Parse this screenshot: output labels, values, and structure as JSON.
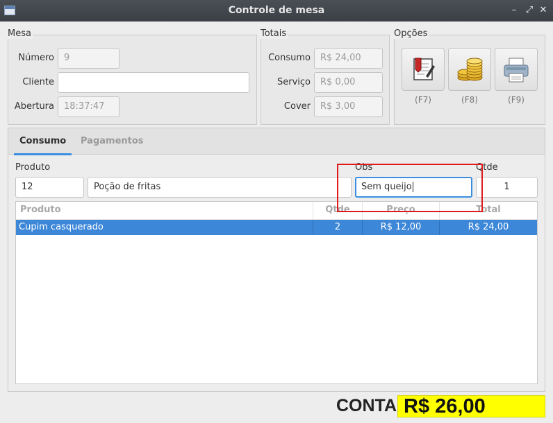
{
  "window": {
    "title": "Controle de mesa",
    "controls": {
      "minimize": "–",
      "maximize": "⤢",
      "close": "✕"
    }
  },
  "mesa": {
    "group_label": "Mesa",
    "numero_label": "Número",
    "numero_value": "9",
    "cliente_label": "Cliente",
    "cliente_value": "",
    "abertura_label": "Abertura",
    "abertura_value": "18:37:47"
  },
  "totais": {
    "group_label": "Totais",
    "consumo_label": "Consumo",
    "consumo_value": "R$ 24,00",
    "servico_label": "Serviço",
    "servico_value": "R$ 0,00",
    "cover_label": "Cover",
    "cover_value": "R$ 3,00"
  },
  "opcoes": {
    "group_label": "Opções",
    "buttons": [
      {
        "icon": "edit-document-icon",
        "key": "(F7)"
      },
      {
        "icon": "coins-icon",
        "key": "(F8)"
      },
      {
        "icon": "printer-icon",
        "key": "(F9)"
      }
    ]
  },
  "tabs": [
    {
      "label": "Consumo",
      "active": true
    },
    {
      "label": "Pagamentos",
      "active": false
    }
  ],
  "entry": {
    "produto_label": "Produto",
    "produto_code": "12",
    "produto_name": "Poção de fritas",
    "obs_label": "Obs",
    "obs_value": "Sem queijo",
    "qtde_label": "Qtde",
    "qtde_value": "1"
  },
  "table": {
    "headers": [
      "Produto",
      "Qtde",
      "Preço",
      "Total"
    ],
    "rows": [
      {
        "produto": "Cupim casquerado",
        "qtde": "2",
        "preco": "R$ 12,00",
        "total": "R$ 24,00",
        "selected": true
      }
    ]
  },
  "footer": {
    "conta_label": "CONTA",
    "conta_value": "R$ 26,00"
  },
  "colors": {
    "accent": "#3b8ee0",
    "selected_row": "#3d87d8",
    "total_background": "#ffff00",
    "annotation_box": "#e01b1b"
  }
}
